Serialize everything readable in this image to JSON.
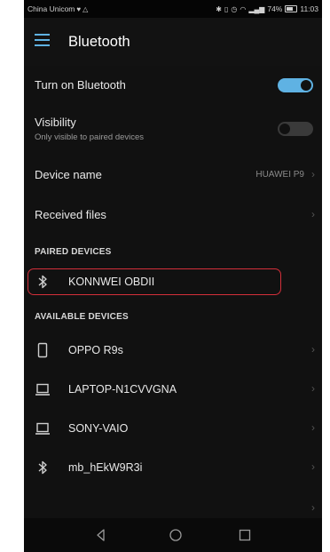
{
  "status_bar": {
    "carrier": "China Unicom",
    "battery_percent": "74%",
    "time": "11:03"
  },
  "app_bar": {
    "title": "Bluetooth",
    "menu_icon": "hamburger-menu-icon"
  },
  "settings": {
    "turn_on_bluetooth": {
      "label": "Turn on Bluetooth",
      "enabled": true
    },
    "visibility": {
      "label": "Visibility",
      "sublabel": "Only visible to paired devices",
      "enabled": false
    },
    "device_name": {
      "label": "Device name",
      "value": "HUAWEI P9"
    },
    "received_files": {
      "label": "Received files"
    }
  },
  "paired_devices": {
    "header": "PAIRED DEVICES",
    "items": [
      {
        "name": "KONNWEI OBDII",
        "icon": "bluetooth-icon"
      }
    ]
  },
  "available_devices": {
    "header": "AVAILABLE DEVICES",
    "items": [
      {
        "name": "OPPO R9s",
        "icon": "phone-icon"
      },
      {
        "name": "LAPTOP-N1CVVGNA",
        "icon": "laptop-icon"
      },
      {
        "name": "SONY-VAIO",
        "icon": "laptop-icon"
      },
      {
        "name": "mb_hEkW9R3i",
        "icon": "bluetooth-icon"
      }
    ]
  },
  "colors": {
    "accent": "#5fb2e3",
    "highlight": "#d32f3a",
    "background": "#111111"
  }
}
